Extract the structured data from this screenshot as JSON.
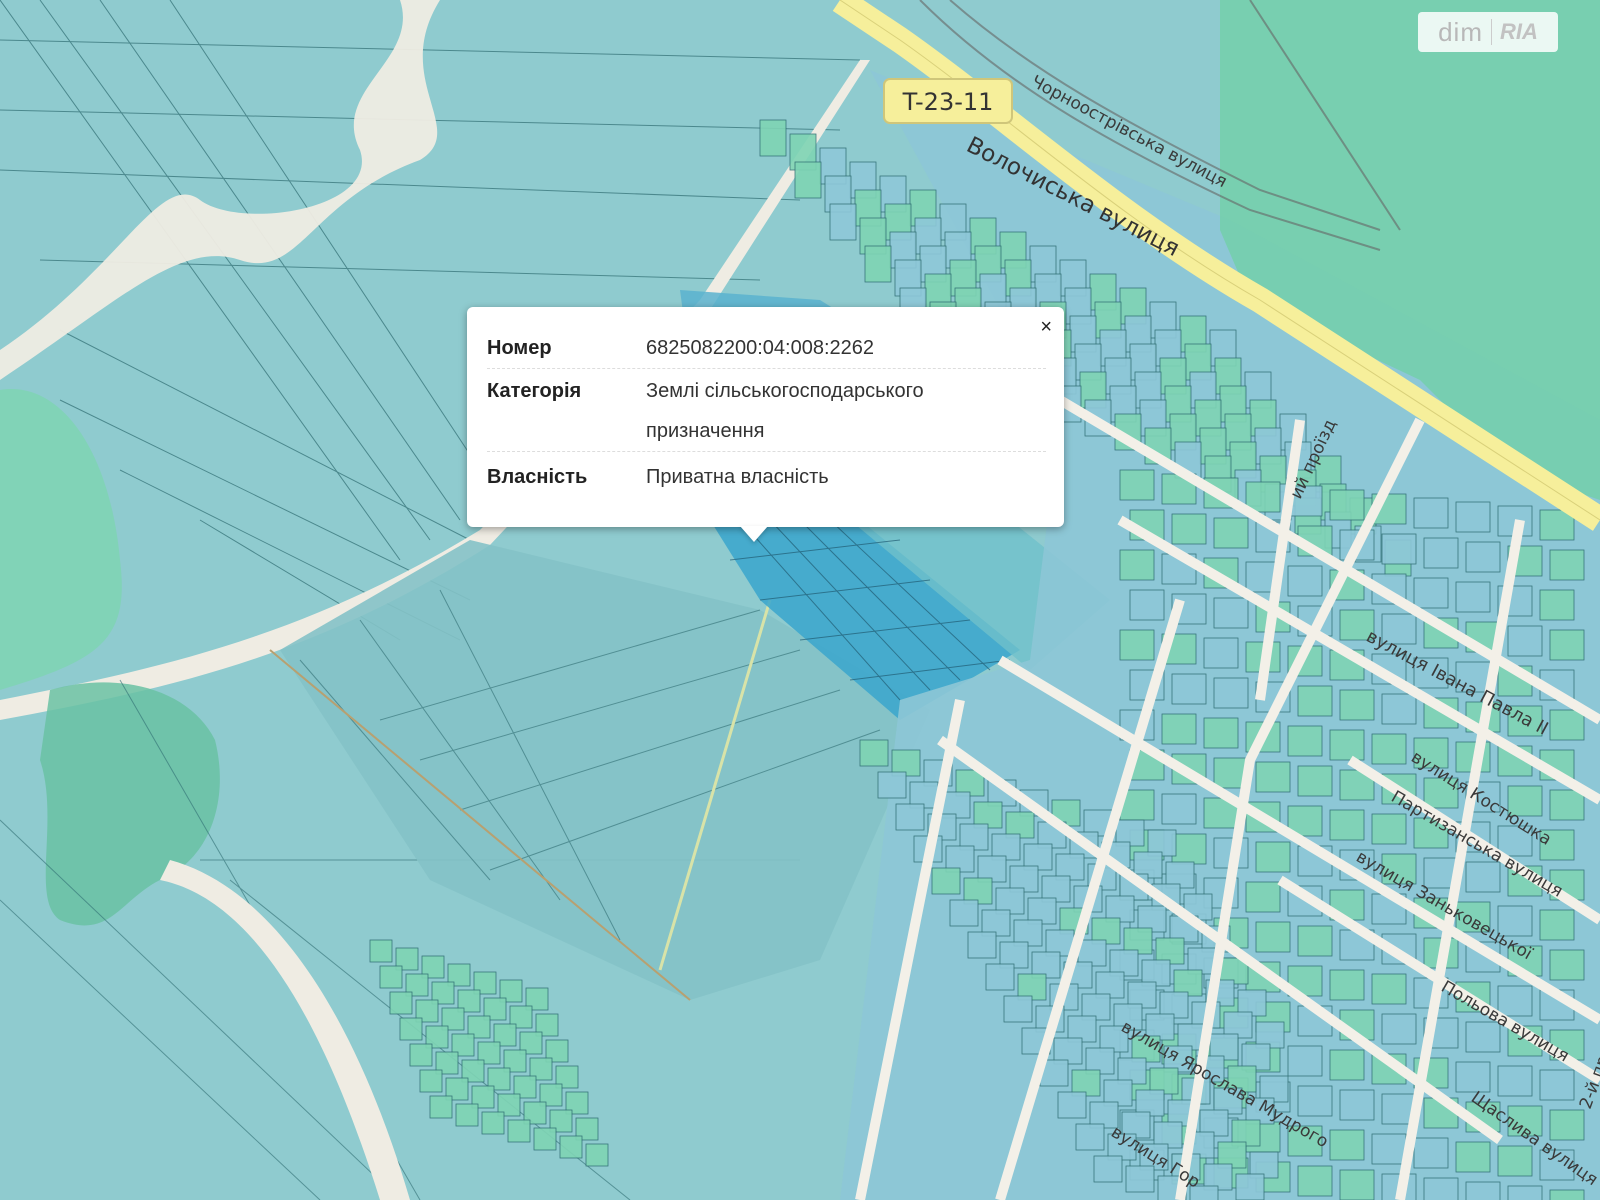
{
  "map": {
    "road_badge": "T-23-11",
    "street_labels": {
      "volochyska": "Волочиська вулиця",
      "chornostrivska": "Чорноострівська вулиця",
      "ivana_pavla": "вулиця Івана Павла ІІ",
      "kostiushka": "вулиця Костюшка",
      "partyzanska": "Партизанська вулиця",
      "zankovetskoi": "вулиця Заньковецької",
      "polova": "Польова вулиця",
      "shchaslyva": "Щаслива вулиця",
      "druha": "2-й пров",
      "proizd": "ий проїзд",
      "mudroho": "вулиця Ярослава Мудрого",
      "hor": "вулиця Гор"
    }
  },
  "popup": {
    "rows": [
      {
        "key": "Номер",
        "value": "6825082200:04:008:2262"
      },
      {
        "key": "Категорія",
        "value": "Землі сільськогосподарського призначення"
      },
      {
        "key": "Власність",
        "value": "Приватна власність"
      }
    ],
    "close_label": "×"
  },
  "watermark": {
    "left": "dim",
    "right": "RIA"
  },
  "colors": {
    "parcel_field": "#8fcbcf",
    "parcel_green": "#7fd4b4",
    "parcel_highlight": "#3aa6cc",
    "road": "#f0ecdf",
    "main_road": "#f6ef9b"
  }
}
